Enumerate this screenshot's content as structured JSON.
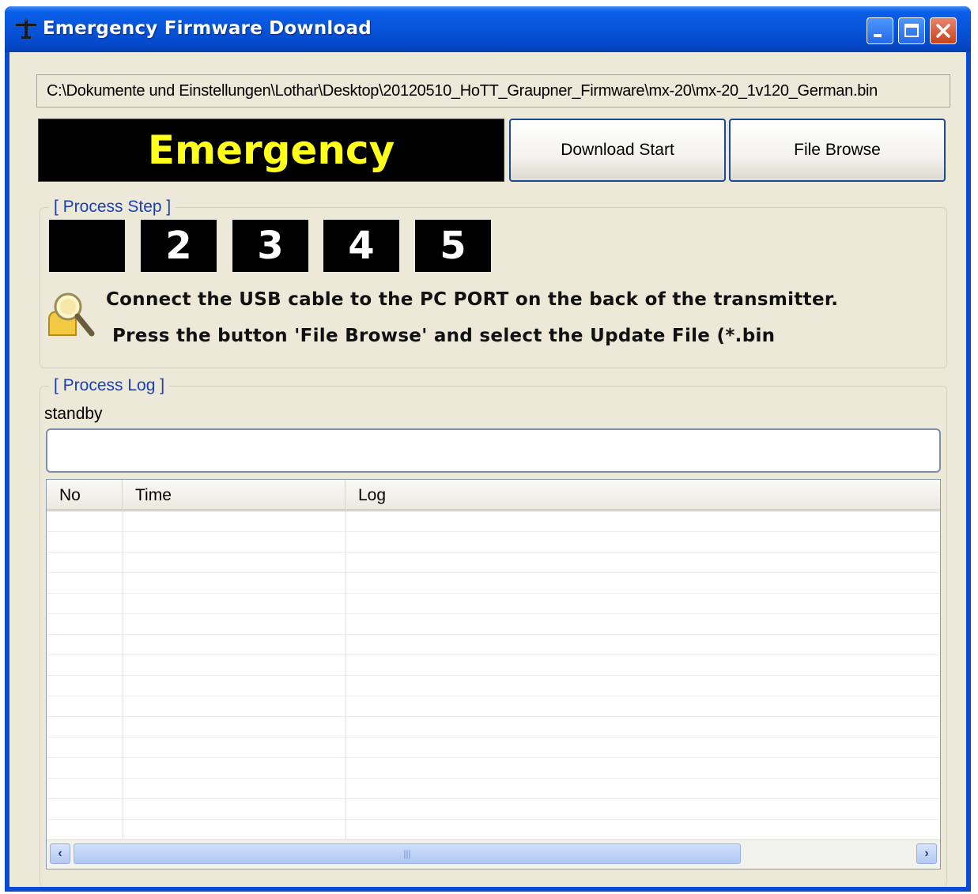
{
  "window": {
    "title": "Emergency Firmware Download"
  },
  "file": {
    "path": "C:\\Dokumente und Einstellungen\\Lothar\\Desktop\\20120510_HoTT_Graupner_Firmware\\mx-20\\mx-20_1v120_German.bin"
  },
  "mode_banner": "Emergency",
  "buttons": {
    "download_start": "Download Start",
    "file_browse": "File Browse"
  },
  "process_step": {
    "label": "[ Process Step ]",
    "steps": [
      "",
      "2",
      "3",
      "4",
      "5"
    ],
    "message_line1": "Connect the USB cable to the PC PORT on the back of the transmitter.",
    "message_line2": "Press the button 'File Browse' and select the Update File (*.bin"
  },
  "process_log": {
    "label": "[ Process Log ]",
    "status": "standby",
    "columns": [
      "No",
      "Time",
      "Log"
    ],
    "rows": []
  },
  "colors": {
    "title_bar": "#0654d9",
    "banner_text": "#ffff1a",
    "group_label": "#1a3fb8",
    "client_bg": "#ece9d8"
  }
}
